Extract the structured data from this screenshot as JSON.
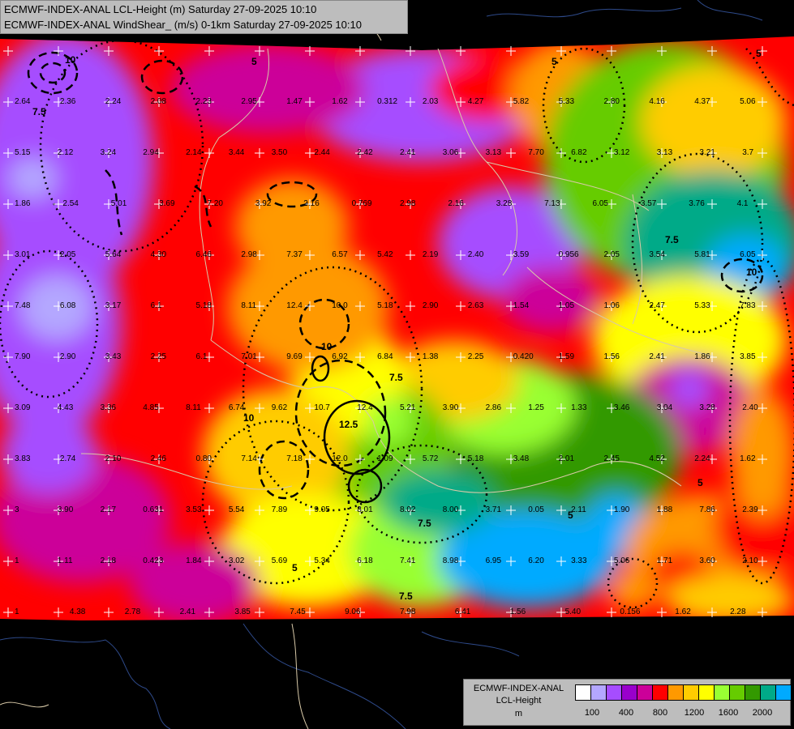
{
  "header": {
    "line1": "ECMWF-INDEX-ANAL LCL-Height (m) Saturday 27-09-2025 10:10",
    "line2": "ECMWF-INDEX-ANAL WindShear_ (m/s) 0-1km Saturday 27-09-2025 10:10"
  },
  "legend": {
    "title1": "ECMWF-INDEX-ANAL",
    "title2": "LCL-Height",
    "title3": "m",
    "colors": [
      "#ffffff",
      "#b4a7ff",
      "#a64dff",
      "#9900cc",
      "#cc0099",
      "#ff0000",
      "#ff9900",
      "#ffcc00",
      "#ffff00",
      "#99ff33",
      "#66cc00",
      "#339900",
      "#00aa88",
      "#00aaff"
    ],
    "ticks": [
      "100",
      "400",
      "800",
      "1200",
      "1600",
      "2000"
    ]
  },
  "contour_labels": [
    "10",
    "7.5",
    "5",
    "12.5"
  ],
  "station_values": [
    {
      "v": "2.64"
    },
    {
      "v": "2.36"
    },
    {
      "v": "2.24"
    },
    {
      "v": "2.08"
    },
    {
      "v": "2.23"
    },
    {
      "v": "2.95"
    },
    {
      "v": "1.47"
    },
    {
      "v": "1.62"
    },
    {
      "v": "0.312"
    },
    {
      "v": "2.03"
    },
    {
      "v": "4.27"
    },
    {
      "v": "5.82"
    },
    {
      "v": "5.33"
    },
    {
      "v": "2.80"
    },
    {
      "v": "4.16"
    },
    {
      "v": "4.37"
    },
    {
      "v": "5.06"
    },
    {
      "v": "5.15"
    },
    {
      "v": "2.12"
    },
    {
      "v": "3.24"
    },
    {
      "v": "2.94"
    },
    {
      "v": "2.14"
    },
    {
      "v": "3.44"
    },
    {
      "v": "3.50"
    },
    {
      "v": "2.44"
    },
    {
      "v": "2.42"
    },
    {
      "v": "2.41"
    },
    {
      "v": "3.06"
    },
    {
      "v": "3.13"
    },
    {
      "v": "7.70"
    },
    {
      "v": "6.82"
    },
    {
      "v": "3.12"
    },
    {
      "v": "3.13"
    },
    {
      "v": "3.21"
    },
    {
      "v": "3.7"
    },
    {
      "v": "1.86"
    },
    {
      "v": "2.54"
    },
    {
      "v": "5.01"
    },
    {
      "v": "3.69"
    },
    {
      "v": "7.20"
    },
    {
      "v": "3.92"
    },
    {
      "v": "2.16"
    },
    {
      "v": "0.769"
    },
    {
      "v": "2.98"
    },
    {
      "v": "2.16"
    },
    {
      "v": "3.28"
    },
    {
      "v": "7.13"
    },
    {
      "v": "6.05"
    },
    {
      "v": "3.57"
    },
    {
      "v": "3.76"
    },
    {
      "v": "4.1"
    },
    {
      "v": "3.01"
    },
    {
      "v": "2.05"
    },
    {
      "v": "5.64"
    },
    {
      "v": "4.30"
    },
    {
      "v": "6.46"
    },
    {
      "v": "2.98"
    },
    {
      "v": "7.37"
    },
    {
      "v": "6.57"
    },
    {
      "v": "5.42"
    },
    {
      "v": "2.19"
    },
    {
      "v": "2.40"
    },
    {
      "v": "3.59"
    },
    {
      "v": "0.956"
    },
    {
      "v": "2.05"
    },
    {
      "v": "3.54"
    },
    {
      "v": "5.81"
    },
    {
      "v": "6.05"
    },
    {
      "v": "7.48"
    },
    {
      "v": "6.08"
    },
    {
      "v": "3.17"
    },
    {
      "v": "6.1"
    },
    {
      "v": "5.18"
    },
    {
      "v": "8.11"
    },
    {
      "v": "12.4"
    },
    {
      "v": "10.0"
    },
    {
      "v": "5.18"
    },
    {
      "v": "2.90"
    },
    {
      "v": "2.63"
    },
    {
      "v": "1.54"
    },
    {
      "v": "1.05"
    },
    {
      "v": "1.06"
    },
    {
      "v": "2.47"
    },
    {
      "v": "5.33"
    },
    {
      "v": "7.83"
    },
    {
      "v": "7.90"
    },
    {
      "v": "2.90"
    },
    {
      "v": "3.43"
    },
    {
      "v": "2.25"
    },
    {
      "v": "6.1"
    },
    {
      "v": "7.01"
    },
    {
      "v": "9.69"
    },
    {
      "v": "6.92"
    },
    {
      "v": "6.84"
    },
    {
      "v": "1.38"
    },
    {
      "v": "2.25"
    },
    {
      "v": "0.420"
    },
    {
      "v": "1.59"
    },
    {
      "v": "1.56"
    },
    {
      "v": "2.41"
    },
    {
      "v": "1.86"
    },
    {
      "v": "3.85"
    },
    {
      "v": "3.09"
    },
    {
      "v": "4.43"
    },
    {
      "v": "3.36"
    },
    {
      "v": "4.85"
    },
    {
      "v": "8.11"
    },
    {
      "v": "6.74"
    },
    {
      "v": "9.62"
    },
    {
      "v": "10.7"
    },
    {
      "v": "12.4"
    },
    {
      "v": "5.21"
    },
    {
      "v": "3.90"
    },
    {
      "v": "2.86"
    },
    {
      "v": "1.25"
    },
    {
      "v": "1.33"
    },
    {
      "v": "3.46"
    },
    {
      "v": "3.04"
    },
    {
      "v": "3.28"
    },
    {
      "v": "2.40"
    },
    {
      "v": "3.83"
    },
    {
      "v": "2.74"
    },
    {
      "v": "2.10"
    },
    {
      "v": "2.46"
    },
    {
      "v": "0.80"
    },
    {
      "v": "7.14"
    },
    {
      "v": "7.18"
    },
    {
      "v": "12.0"
    },
    {
      "v": "1.09"
    },
    {
      "v": "5.72"
    },
    {
      "v": "5.18"
    },
    {
      "v": "3.48"
    },
    {
      "v": "2.01"
    },
    {
      "v": "2.45"
    },
    {
      "v": "4.52"
    },
    {
      "v": "2.24"
    },
    {
      "v": "1.62"
    },
    {
      "v": "3"
    },
    {
      "v": "3.90"
    },
    {
      "v": "2.17"
    },
    {
      "v": "0.631"
    },
    {
      "v": "3.53"
    },
    {
      "v": "5.54"
    },
    {
      "v": "7.89"
    },
    {
      "v": "9.05"
    },
    {
      "v": "8.01"
    },
    {
      "v": "8.02"
    },
    {
      "v": "8.00"
    },
    {
      "v": "3.71"
    },
    {
      "v": "0.05"
    },
    {
      "v": "2.11"
    },
    {
      "v": "1.90"
    },
    {
      "v": "1.88"
    },
    {
      "v": "7.86"
    },
    {
      "v": "2.39"
    },
    {
      "v": "1"
    },
    {
      "v": "1.11"
    },
    {
      "v": "2.18"
    },
    {
      "v": "0.423"
    },
    {
      "v": "1.84"
    },
    {
      "v": "3.02"
    },
    {
      "v": "5.69"
    },
    {
      "v": "5.34"
    },
    {
      "v": "6.18"
    },
    {
      "v": "7.41"
    },
    {
      "v": "8.98"
    },
    {
      "v": "6.95"
    },
    {
      "v": "6.20"
    },
    {
      "v": "3.33"
    },
    {
      "v": "5.06"
    },
    {
      "v": "1.71"
    },
    {
      "v": "3.60"
    },
    {
      "v": "2.10"
    },
    {
      "v": "1"
    },
    {
      "v": "4.38"
    },
    {
      "v": "2.78"
    },
    {
      "v": "2.41"
    },
    {
      "v": "3.85"
    },
    {
      "v": "7.45"
    },
    {
      "v": "9.06"
    },
    {
      "v": "7.98"
    },
    {
      "v": "6.41"
    },
    {
      "v": "1.56"
    },
    {
      "v": "5.40"
    },
    {
      "v": "0.156"
    },
    {
      "v": "1.62"
    },
    {
      "v": "2.28"
    }
  ]
}
